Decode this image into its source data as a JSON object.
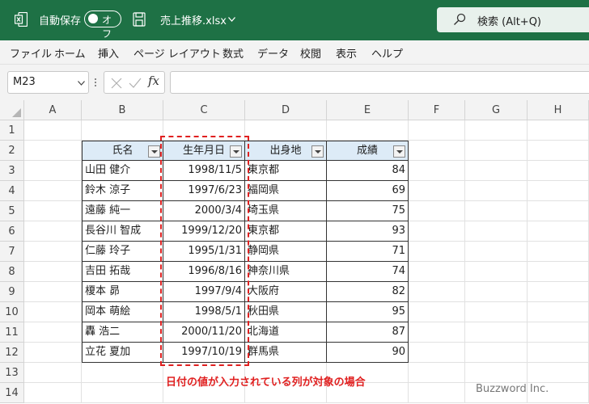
{
  "title_bar": {
    "autosave_label": "自動保存",
    "toggle_text": "オフ",
    "filename": "売上推移.xlsx",
    "search_text": "検索 (Alt+Q)"
  },
  "menu": [
    "ファイル",
    "ホーム",
    "挿入",
    "ページ レイアウト",
    "数式",
    "データ",
    "校閲",
    "表示",
    "ヘルプ"
  ],
  "formula_bar": {
    "name_box": "M23",
    "fx_label": "fx",
    "formula": ""
  },
  "columns": [
    "A",
    "B",
    "C",
    "D",
    "E",
    "F",
    "G",
    "H"
  ],
  "rows": [
    "1",
    "2",
    "3",
    "4",
    "5",
    "6",
    "7",
    "8",
    "9",
    "10",
    "11",
    "12",
    "13",
    "14"
  ],
  "table": {
    "headers": [
      "氏名",
      "生年月日",
      "出身地",
      "成績"
    ],
    "records": [
      [
        "山田 健介",
        "1998/11/5",
        "東京都",
        "84"
      ],
      [
        "鈴木 涼子",
        "1997/6/23",
        "福岡県",
        "69"
      ],
      [
        "遠藤 純一",
        "2000/3/4",
        "埼玉県",
        "75"
      ],
      [
        "長谷川 智成",
        "1999/12/20",
        "東京都",
        "93"
      ],
      [
        "仁藤 玲子",
        "1995/1/31",
        "静岡県",
        "71"
      ],
      [
        "吉田 拓哉",
        "1996/8/16",
        "神奈川県",
        "74"
      ],
      [
        "榎本 昴",
        "1997/9/4",
        "大阪府",
        "82"
      ],
      [
        "岡本 萌絵",
        "1998/5/1",
        "秋田県",
        "95"
      ],
      [
        "轟 浩二",
        "2000/11/20",
        "北海道",
        "87"
      ],
      [
        "立花 夏加",
        "1997/10/19",
        "群馬県",
        "90"
      ]
    ]
  },
  "annotation": "日付の値が入力されている列が対象の場合",
  "watermark": "Buzzword Inc.",
  "colors": {
    "title_bar": "#1e7145",
    "header_fill": "#ddebf7",
    "annotation": "#e02020"
  }
}
